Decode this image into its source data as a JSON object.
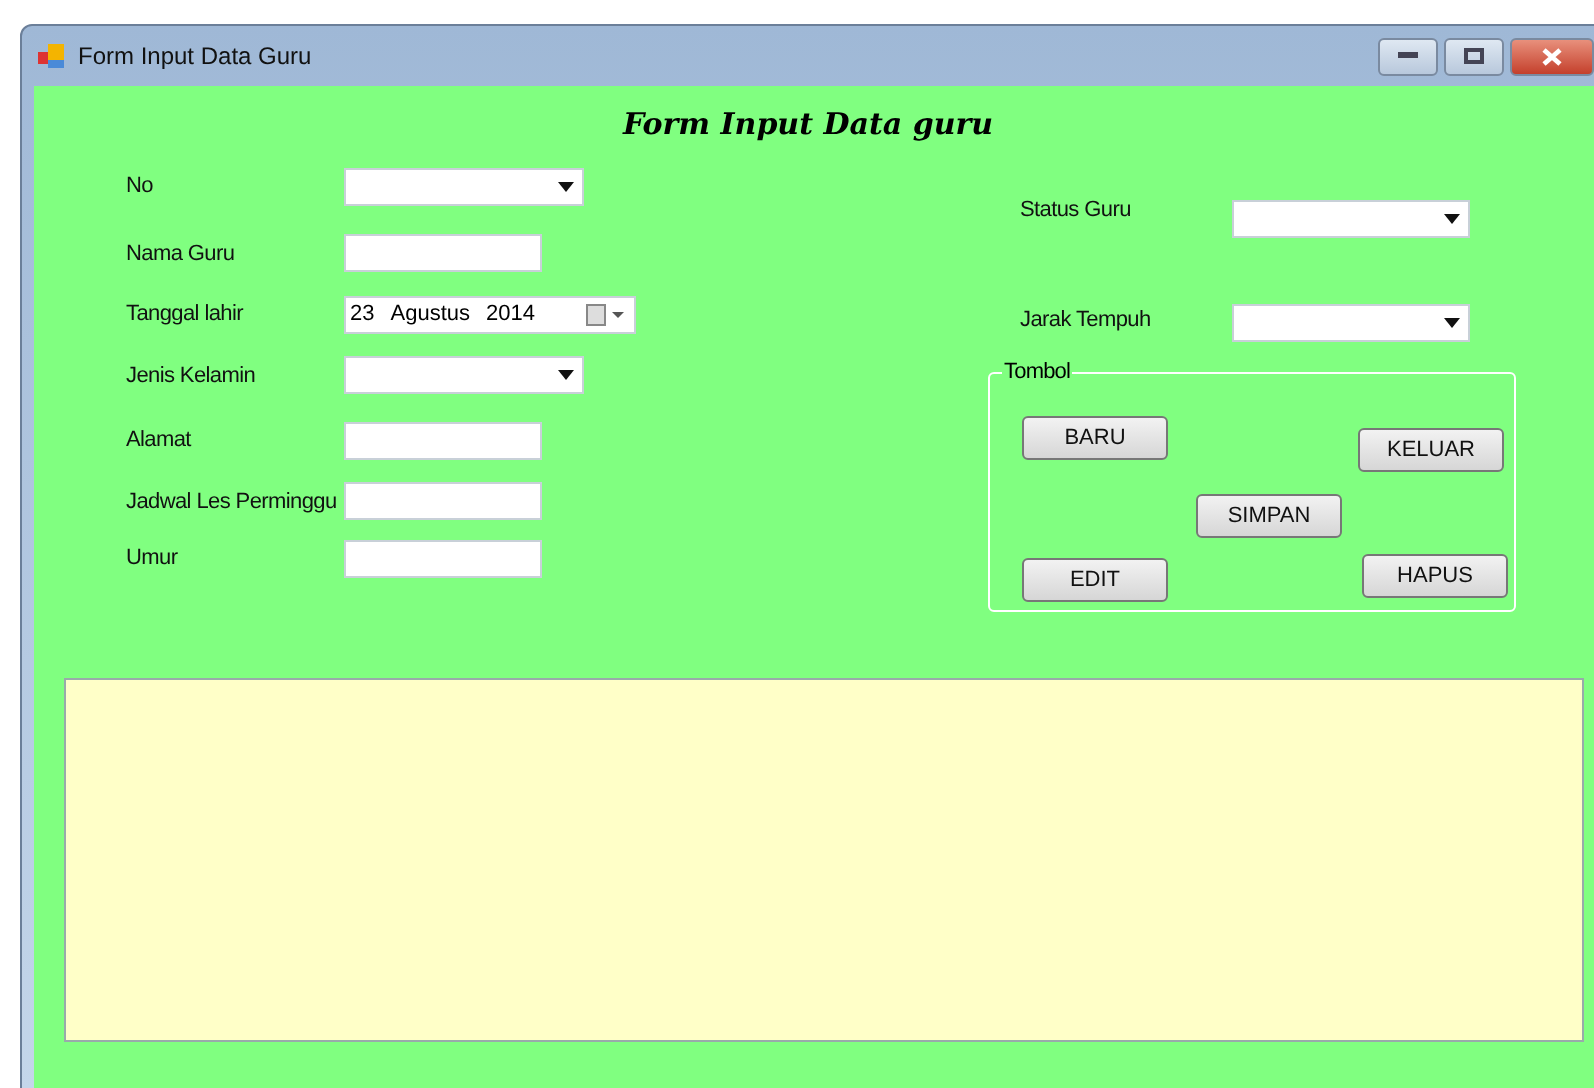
{
  "window": {
    "title": "Form Input Data Guru"
  },
  "heading": "Form Input Data guru",
  "left_fields": [
    {
      "label": "No",
      "kind": "combo"
    },
    {
      "label": "Nama Guru",
      "kind": "text"
    },
    {
      "label": "Tanggal lahir",
      "kind": "date",
      "day": "23",
      "month": "Agustus",
      "year": "2014"
    },
    {
      "label": "Jenis Kelamin",
      "kind": "combo"
    },
    {
      "label": "Alamat",
      "kind": "text"
    },
    {
      "label": "Jadwal Les Perminggu",
      "kind": "text"
    },
    {
      "label": "Umur",
      "kind": "text"
    }
  ],
  "right_fields": [
    {
      "label": "Status Guru",
      "kind": "combo"
    },
    {
      "label": "Jarak Tempuh",
      "kind": "combo"
    }
  ],
  "group": {
    "title": "Tombol",
    "buttons": [
      "BARU",
      "KELUAR",
      "SIMPAN",
      "EDIT",
      "HAPUS"
    ]
  }
}
